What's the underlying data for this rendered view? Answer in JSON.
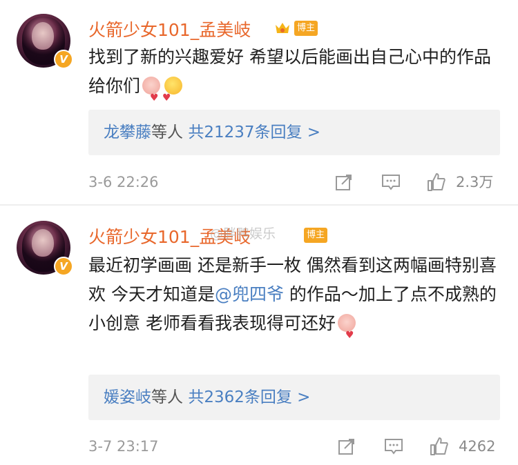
{
  "comments": [
    {
      "username": "火箭少女101_孟美岐",
      "blogger_tag": "博主",
      "verified_badge": "V",
      "text": "找到了新的兴趣爱好 希望以后能画出自己心中的作品给你们",
      "emojis": [
        "blush-emoji",
        "smile-heart-emoji"
      ],
      "reply_summary": {
        "names": "龙攀藤",
        "etc": "等人",
        "count_text": "共21237条回复 >"
      },
      "time": "3-6 22:26",
      "likes": "2.3万"
    },
    {
      "username": "火箭少女101_孟美岐",
      "blogger_tag": "博主",
      "verified_badge": "V",
      "text_part1": "最近初学画画 还是新手一枚 偶然看到这两幅画特别喜欢 今天才知道是",
      "mention": "@兜四爷",
      "text_part2": " 的作品～加上了点不成熟的小创意 老师看看我表现得可还好",
      "emojis": [
        "blush-emoji"
      ],
      "reply_summary": {
        "names": "媛姿岐",
        "etc": "等人",
        "count_text": "共2362条回复 >"
      },
      "time": "3-7 23:17",
      "likes": "4262"
    }
  ],
  "watermark": "@胖鸭娱乐",
  "colors": {
    "username": "#e8672b",
    "link": "#4a7fc1",
    "badge": "#f5a623"
  },
  "icons": [
    "share-icon",
    "comment-icon",
    "like-icon",
    "crown-icon"
  ]
}
